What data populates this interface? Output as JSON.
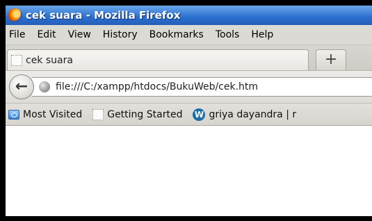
{
  "window": {
    "title": "cek suara - Mozilla Firefox"
  },
  "menu": {
    "items": [
      {
        "label": "File"
      },
      {
        "label": "Edit"
      },
      {
        "label": "View"
      },
      {
        "label": "History"
      },
      {
        "label": "Bookmarks"
      },
      {
        "label": "Tools"
      },
      {
        "label": "Help"
      }
    ]
  },
  "tabs": [
    {
      "label": "cek suara",
      "icon": "blank-page-icon"
    }
  ],
  "new_tab": {
    "label": "+"
  },
  "nav": {
    "back_label": "←",
    "url": "file:///C:/xampp/htdocs/BukuWeb/cek.htm"
  },
  "bookmarks": [
    {
      "label": "Most Visited",
      "icon": "most-visited-icon"
    },
    {
      "label": "Getting Started",
      "icon": "blank-page-icon"
    },
    {
      "label": "griya dayandra | r",
      "icon": "wordpress-icon"
    }
  ],
  "colors": {
    "titlebar": "#2b6fd0",
    "chrome": "#dcdad5",
    "frame": "#000000"
  }
}
